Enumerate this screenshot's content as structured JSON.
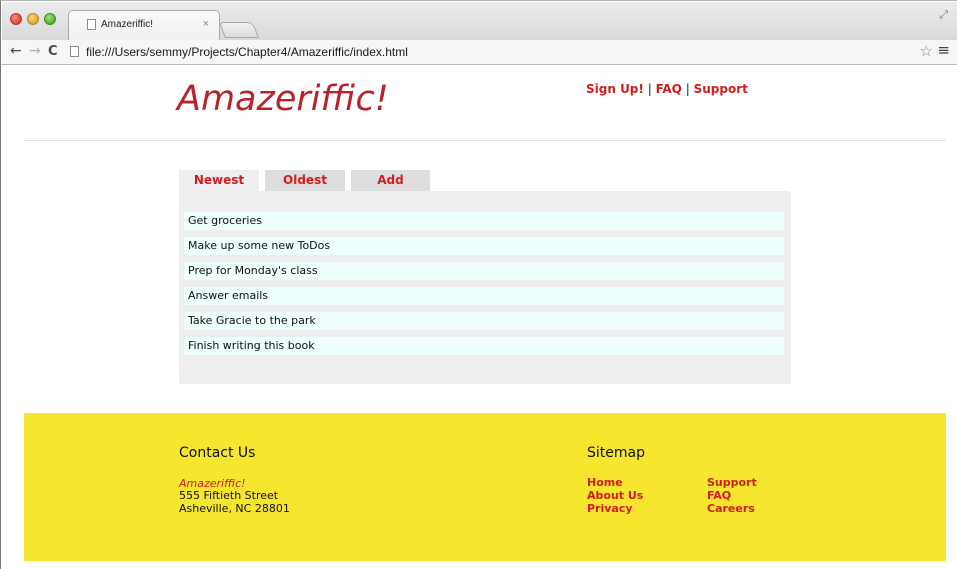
{
  "browser": {
    "tab_title": "Amazeriffic!",
    "tab_close": "×",
    "url": "file:///Users/semmy/Projects/Chapter4/Amazeriffic/index.html"
  },
  "header": {
    "logo": "Amazeriffic!",
    "nav": {
      "signup": "Sign Up!",
      "sep1": "|",
      "faq": "FAQ",
      "sep2": "|",
      "support": "Support"
    }
  },
  "tabs": [
    {
      "label": "Newest",
      "active": true
    },
    {
      "label": "Oldest",
      "active": false
    },
    {
      "label": "Add",
      "active": false
    }
  ],
  "todos": [
    "Get groceries",
    "Make up some new ToDos",
    "Prep for Monday's class",
    "Answer emails",
    "Take Gracie to the park",
    "Finish writing this book"
  ],
  "footer": {
    "contact": {
      "heading": "Contact Us",
      "company": "Amazeriffic!",
      "street": "555 Fiftieth Street",
      "city": "Asheville, NC 28801"
    },
    "sitemap": {
      "heading": "Sitemap",
      "col1": [
        "Home",
        "About Us",
        "Privacy"
      ],
      "col2": [
        "Support",
        "FAQ",
        "Careers"
      ]
    }
  },
  "colors": {
    "accent_red": "#d21d1d",
    "logo_red": "#b8232b",
    "footer_yellow": "#f6e62e",
    "todo_bg": "#eefffe"
  }
}
